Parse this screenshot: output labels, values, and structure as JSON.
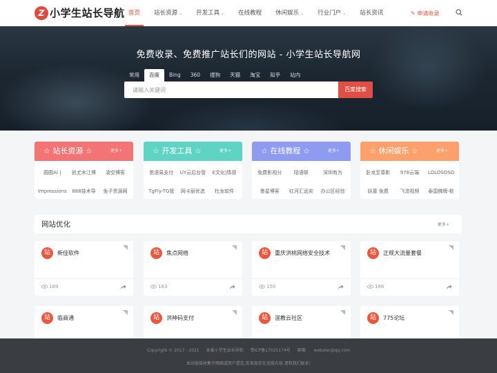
{
  "header": {
    "logo_mark": "Z",
    "logo_text": "小学生站长导航",
    "nav": [
      {
        "label": "首页",
        "active": true,
        "has_dropdown": false
      },
      {
        "label": "站长资源",
        "active": false,
        "has_dropdown": true
      },
      {
        "label": "开发工具",
        "active": false,
        "has_dropdown": true
      },
      {
        "label": "在线教程",
        "active": false,
        "has_dropdown": false
      },
      {
        "label": "休闲娱乐",
        "active": false,
        "has_dropdown": true
      },
      {
        "label": "行业门户",
        "active": false,
        "has_dropdown": true
      },
      {
        "label": "站长资讯",
        "active": false,
        "has_dropdown": false
      }
    ],
    "chevron": "⌄",
    "apply_label": "申请收录",
    "apply_icon": "pencil-icon"
  },
  "hero": {
    "title": "免费收录、免费推广站长们的网站 - 小学生站长导航网",
    "tabs": [
      "常用",
      "百度",
      "Bing",
      "360",
      "搜狗",
      "天猫",
      "淘宝",
      "知乎",
      "站内"
    ],
    "active_tab": 1,
    "search_placeholder": "请输入关键词",
    "search_button": "百度搜索"
  },
  "categories": [
    {
      "title": "☆ 站长资源 ☆",
      "more": "更多+",
      "color": "#f27474",
      "links": [
        "圆圆AI |",
        "凯尤木江博",
        "凌空博客",
        "Impressions",
        "888技术导",
        "免子资源网"
      ]
    },
    {
      "title": "☆ 开发工具 ☆",
      "more": "更多+",
      "color": "#5fd3c4",
      "links": [
        "思语易支付",
        "UY云后台管",
        "E文化|情感",
        "TgFly-TG管",
        "网卡丽优选",
        "杜龙软件"
      ]
    },
    {
      "title": "☆ 在线教程 ☆",
      "more": "更多+",
      "color": "#8e9bf0",
      "links": [
        "免费影视分",
        "陌语联",
        "深圳有为",
        "墨星博客",
        "红河汇远实",
        "办公区经验"
      ]
    },
    {
      "title": "☆ 休闲娱乐 ☆",
      "more": "更多+",
      "color": "#fca16b",
      "links": [
        "卧龙至尊影",
        "978云端",
        "LOLOSOSO",
        "妖童 免费",
        "飞流视频",
        "泰国佛牌-桩"
      ]
    }
  ],
  "section": {
    "title": "网站优化",
    "more": "更多+"
  },
  "cards": [
    {
      "badge": "站",
      "name": "新佳软件",
      "sub": "...",
      "views": "169"
    },
    {
      "badge": "站",
      "name": "焦点网络",
      "sub": "...",
      "views": "163"
    },
    {
      "badge": "站",
      "name": "重庆洪桃网络安全技术",
      "sub": "...",
      "views": "150"
    },
    {
      "badge": "站",
      "name": "正规大流量套餐",
      "sub": "...",
      "views": "186"
    },
    {
      "badge": "站",
      "name": "临商通",
      "sub": "...",
      "views": ""
    },
    {
      "badge": "站",
      "name": "洪神码支付",
      "sub": "...",
      "views": ""
    },
    {
      "badge": "站",
      "name": "泯教云社区",
      "sub": "...",
      "views": ""
    },
    {
      "badge": "站",
      "name": "775论坛",
      "sub": "...",
      "views": ""
    }
  ],
  "footer": {
    "copyright": "Copyright © 2017 - 2021",
    "brand": "亲爱小学生站长导航",
    "icp": "粤ICP备17025174号",
    "email_label": "邮箱:",
    "email": "webster@qq.com",
    "notice": "本站链接收集于网络或用户提交,若发现存在违规内容,请和我们联系!"
  }
}
